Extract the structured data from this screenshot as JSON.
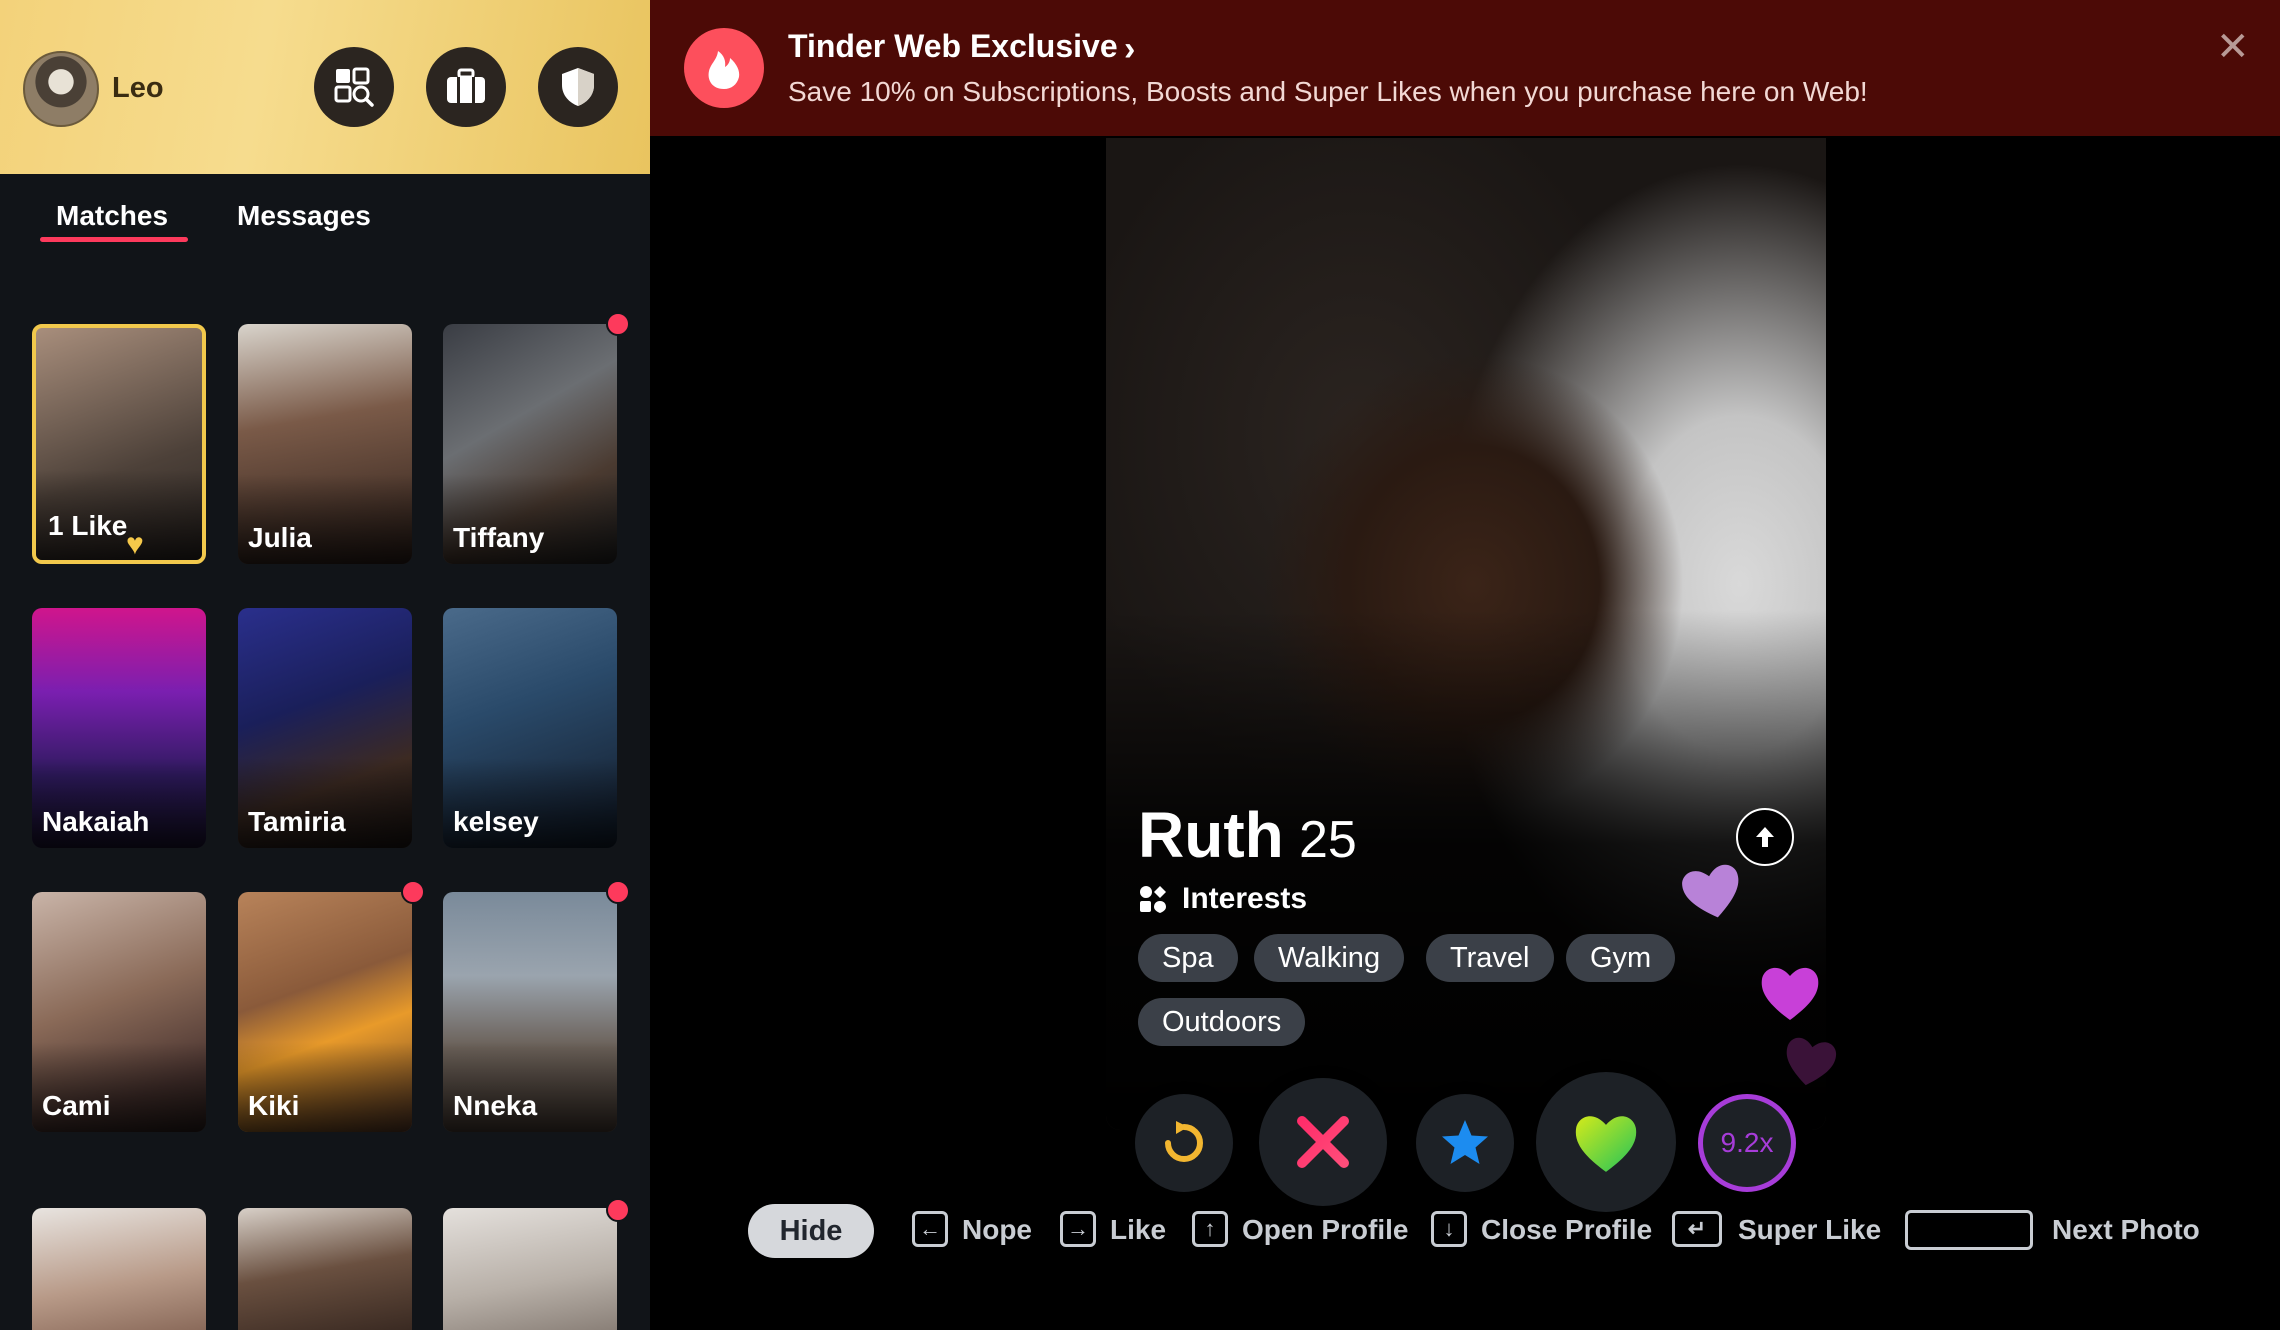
{
  "user": {
    "name": "Leo"
  },
  "header_icons": [
    "explore-icon",
    "briefcase-icon",
    "shield-icon"
  ],
  "tabs": [
    {
      "label": "Matches",
      "active": true
    },
    {
      "label": "Messages",
      "active": false
    }
  ],
  "matches": [
    {
      "name": "1 Like",
      "highlight": true,
      "unread": false
    },
    {
      "name": "Julia",
      "unread": false
    },
    {
      "name": "Tiffany",
      "unread": true
    },
    {
      "name": "Nakaiah",
      "unread": false
    },
    {
      "name": "Tamiria",
      "unread": false
    },
    {
      "name": "kelsey",
      "unread": false
    },
    {
      "name": "Cami",
      "unread": false
    },
    {
      "name": "Kiki",
      "unread": true
    },
    {
      "name": "Nneka",
      "unread": true
    },
    {
      "name": "",
      "unread": false
    },
    {
      "name": "",
      "unread": false
    },
    {
      "name": "",
      "unread": true
    }
  ],
  "banner": {
    "title": "Tinder Web Exclusive",
    "text": "Save 10% on Subscriptions, Boosts and Super Likes when you purchase here on Web!"
  },
  "profile": {
    "name": "Ruth",
    "age": "25",
    "interests_label": "Interests",
    "interests": [
      "Spa",
      "Walking",
      "Travel",
      "Gym",
      "Outdoors"
    ]
  },
  "actions": {
    "boost_multiplier": "9.2x"
  },
  "shortcuts": {
    "hide": "Hide",
    "nope": "Nope",
    "like": "Like",
    "open_profile": "Open Profile",
    "close_profile": "Close Profile",
    "super_like": "Super Like",
    "next_photo": "Next Photo"
  },
  "colors": {
    "accent": "#fd3a5c",
    "banner_bg": "#4c0a06",
    "sidebar_bg": "#111418",
    "header_gold": "#f3d27a"
  }
}
